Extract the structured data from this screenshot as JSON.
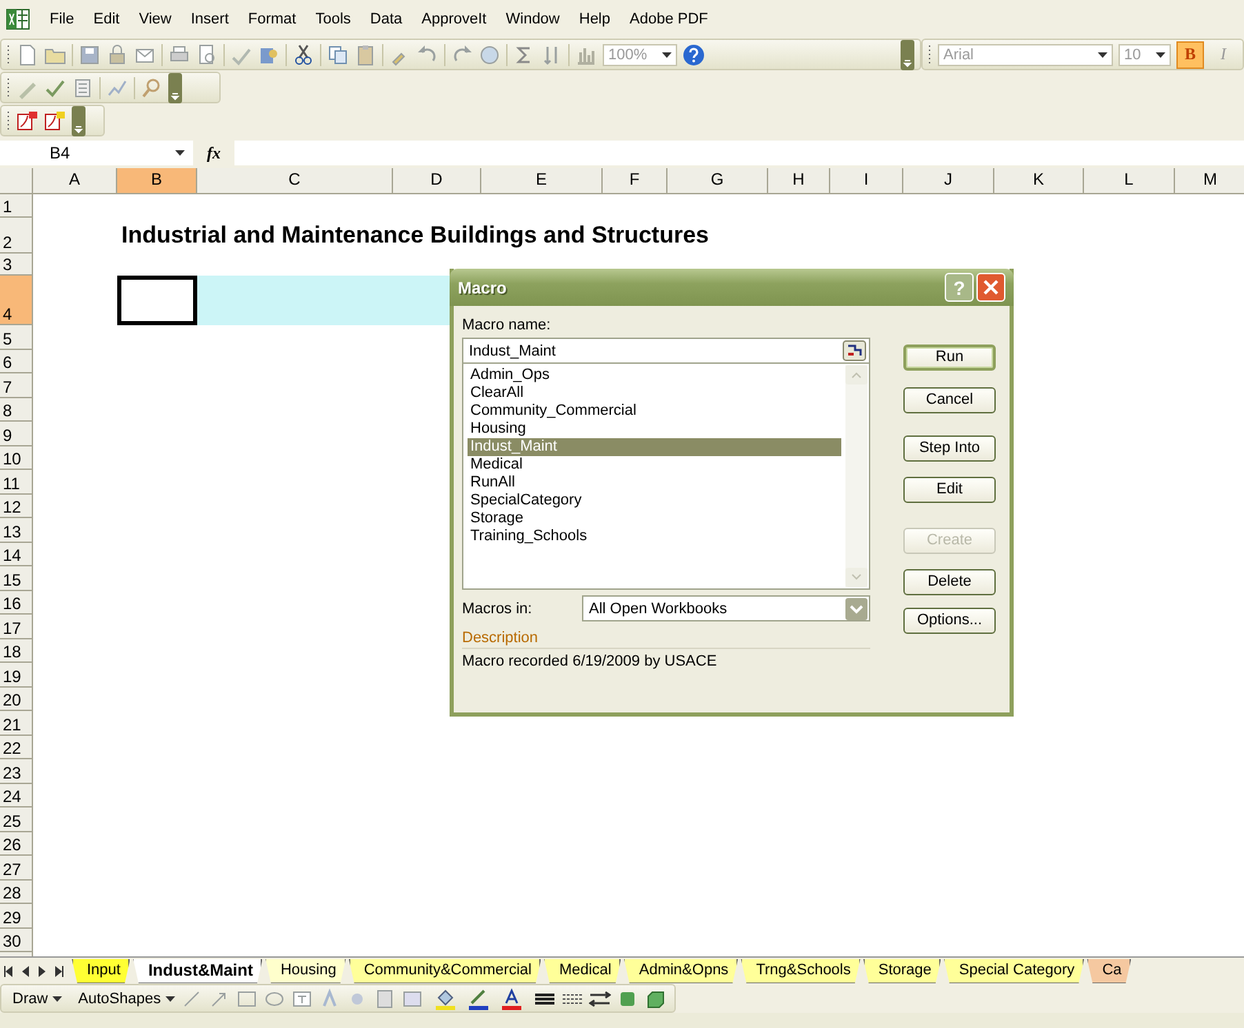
{
  "menu_bar": {
    "items": [
      "File",
      "Edit",
      "View",
      "Insert",
      "Format",
      "Tools",
      "Data",
      "ApproveIt",
      "Window",
      "Help",
      "Adobe PDF"
    ]
  },
  "standard_toolbar": {
    "zoom": "100%",
    "font": "Arial",
    "font_size": "10",
    "format_buttons": [
      {
        "label": "B",
        "selected": true
      },
      {
        "label": "I",
        "selected": false
      }
    ]
  },
  "formula_bar": {
    "name_box": "B4",
    "function_label": "fx"
  },
  "sheet": {
    "columns": [
      {
        "label": "A",
        "selected": false
      },
      {
        "label": "B",
        "selected": true
      },
      {
        "label": "C",
        "selected": false
      },
      {
        "label": "D",
        "selected": false
      },
      {
        "label": "E",
        "selected": false
      },
      {
        "label": "F",
        "selected": false
      },
      {
        "label": "G",
        "selected": false
      },
      {
        "label": "H",
        "selected": false
      },
      {
        "label": "I",
        "selected": false
      },
      {
        "label": "J",
        "selected": false
      },
      {
        "label": "K",
        "selected": false
      },
      {
        "label": "L",
        "selected": false
      },
      {
        "label": "M",
        "selected": false
      }
    ],
    "title": "Industrial and Maintenance Buildings and Structures",
    "rows": [
      {
        "label": "1",
        "selected": false
      },
      {
        "label": "2",
        "selected": false
      },
      {
        "label": "3",
        "selected": false
      },
      {
        "label": "4",
        "selected": true,
        "cells": [
          {
            "kind": "blank"
          },
          {
            "kind": "active"
          },
          {
            "kind": "filled",
            "color": "#ccf5f7"
          },
          {
            "kind": "filled",
            "color": "#ccf5f7"
          }
        ]
      },
      {
        "label": "5",
        "selected": false
      },
      {
        "label": "6",
        "selected": false
      },
      {
        "label": "7",
        "selected": false
      },
      {
        "label": "8",
        "selected": false
      },
      {
        "label": "9",
        "selected": false
      },
      {
        "label": "10",
        "selected": false
      },
      {
        "label": "11",
        "selected": false
      },
      {
        "label": "12",
        "selected": false
      },
      {
        "label": "13",
        "selected": false
      },
      {
        "label": "14",
        "selected": false
      },
      {
        "label": "15",
        "selected": false
      },
      {
        "label": "16",
        "selected": false
      },
      {
        "label": "17",
        "selected": false
      },
      {
        "label": "18",
        "selected": false
      },
      {
        "label": "19",
        "selected": false
      },
      {
        "label": "20",
        "selected": false
      },
      {
        "label": "21",
        "selected": false
      },
      {
        "label": "22",
        "selected": false
      },
      {
        "label": "23",
        "selected": false
      },
      {
        "label": "24",
        "selected": false
      },
      {
        "label": "25",
        "selected": false
      },
      {
        "label": "26",
        "selected": false
      },
      {
        "label": "27",
        "selected": false
      },
      {
        "label": "28",
        "selected": false
      },
      {
        "label": "29",
        "selected": false
      },
      {
        "label": "30",
        "selected": false
      }
    ]
  },
  "dialog": {
    "title": "Macro",
    "help": "?",
    "macro_name_label": "Macro name:",
    "macro_name": "Indust_Maint",
    "macros": [
      {
        "label": "Admin_Ops",
        "selected": false
      },
      {
        "label": "ClearAll",
        "selected": false
      },
      {
        "label": "Community_Commercial",
        "selected": false
      },
      {
        "label": "Housing",
        "selected": false
      },
      {
        "label": "Indust_Maint",
        "selected": true
      },
      {
        "label": "Medical",
        "selected": false
      },
      {
        "label": "RunAll",
        "selected": false
      },
      {
        "label": "SpecialCategory",
        "selected": false
      },
      {
        "label": "Storage",
        "selected": false
      },
      {
        "label": "Training_Schools",
        "selected": false
      }
    ],
    "buttons": [
      {
        "label": "Run",
        "default": true,
        "disabled": false
      },
      {
        "label": "Cancel",
        "default": false,
        "disabled": false
      },
      {
        "label": "Step Into",
        "default": false,
        "disabled": false
      },
      {
        "label": "Edit",
        "default": false,
        "disabled": false
      },
      {
        "label": "Create",
        "default": false,
        "disabled": true
      },
      {
        "label": "Delete",
        "default": false,
        "disabled": false
      },
      {
        "label": "Options...",
        "default": false,
        "disabled": false
      }
    ],
    "macros_in_label": "Macros in:",
    "macros_in": "All Open Workbooks",
    "description_label": "Description",
    "description": "Macro recorded 6/19/2009 by USACE"
  },
  "sheet_tabs": [
    {
      "label": "Input",
      "selected": false,
      "color": "#ffff33"
    },
    {
      "label": "Indust&Maint",
      "selected": true,
      "color": "#ffffff"
    },
    {
      "label": "Housing",
      "selected": false,
      "color": "#ffffcc"
    },
    {
      "label": "Community&Commercial",
      "selected": false,
      "color": "#ffff99"
    },
    {
      "label": "Medical",
      "selected": false,
      "color": "#ffff99"
    },
    {
      "label": "Admin&Opns",
      "selected": false,
      "color": "#ffff99"
    },
    {
      "label": "Trng&Schools",
      "selected": false,
      "color": "#ffff99"
    },
    {
      "label": "Storage",
      "selected": false,
      "color": "#ffff99"
    },
    {
      "label": "Special Category",
      "selected": false,
      "color": "#ffff99"
    },
    {
      "label": "Ca",
      "selected": false,
      "color": "#f5c8a0"
    }
  ],
  "drawing_toolbar": {
    "draw": "Draw",
    "autoshapes": "AutoShapes"
  }
}
